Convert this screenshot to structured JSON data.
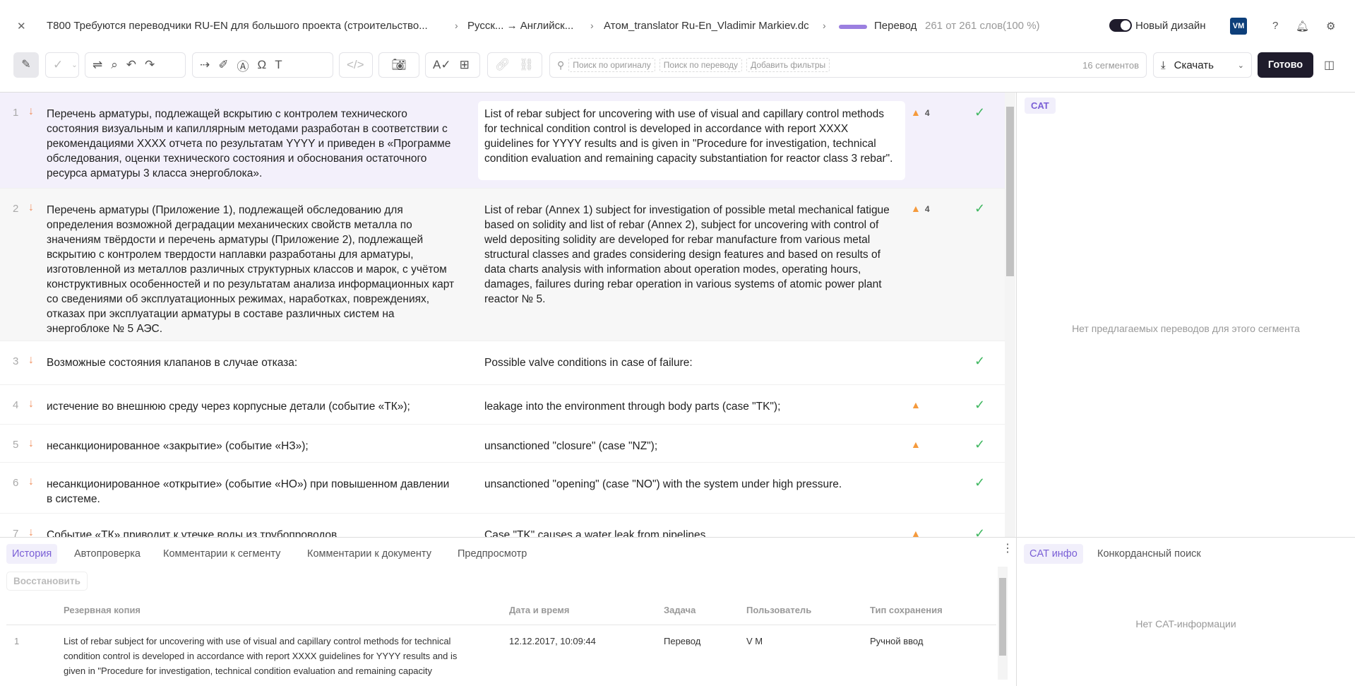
{
  "header": {
    "close_icon": "close-icon",
    "project": "T800 Требуются переводчики RU-EN для большого проекта (строительство...",
    "languages": "Русск... → Английск...",
    "document": "Атом_translator Ru-En_Vladimir Markiev.dc",
    "stage": "Перевод",
    "progress_text": "261 от 261 слов",
    "progress_percent": "(100 %)",
    "progress_value": 100,
    "stage_color": "#9b7fe0",
    "new_design_label": "Новый дизайн",
    "new_design_on": true,
    "avatar": "VM",
    "avatar_color": "#0d3f7a"
  },
  "toolbar": {
    "search_original": "Поиск по оригиналу",
    "search_translation": "Поиск по переводу",
    "add_filters": "Добавить фильтры",
    "segments_count": "16 сегментов",
    "download": "Скачать",
    "done": "Готово"
  },
  "segments": [
    {
      "num": "1",
      "source": "Перечень арматуры, подлежащей вскрытию с контролем технического состояния визуальным и капиллярным методами разработан в соответствии с рекомендациями XXXX отчета по результатам YYYY и приведен в «Программе обследования, оценки технического состояния и обоснования остаточного ресурса арматуры 3 класса энергоблока».",
      "target": "List of rebar subject for uncovering with use of visual and capillary control methods for technical condition control is developed in accordance with report XXXX guidelines for YYYY results and is given in \"Procedure for investigation, technical condition evaluation and remaining capacity substantiation for reactor class 3 rebar\".",
      "warnings": "4",
      "confirmed": true
    },
    {
      "num": "2",
      "source": "Перечень арматуры (Приложение 1), подлежащей обследованию для определения возможной деградации механических свойств металла по значениям твёрдости и перечень арматуры (Приложение 2), подлежащей вскрытию с контролем твердости наплавки разработаны для арматуры, изготовленной из металлов различных структурных классов и марок, с учётом конструктивных особенностей и по результатам анализа информационных карт со сведениями об эксплуатационных режимах, наработках, повреждениях, отказах при эксплуатации арматуры в составе различных систем на энергоблоке № 5 АЭС.",
      "target": "List of rebar (Annex 1) subject for investigation of possible metal mechanical fatigue based on solidity and list of rebar (Annex 2), subject for uncovering with control of weld depositing solidity are developed for rebar manufacture from various metal structural classes and grades considering design features and based on results of data charts analysis with information about operation modes, operating hours, damages, failures during rebar operation in various systems of atomic power plant reactor № 5.",
      "warnings": "4",
      "confirmed": true
    },
    {
      "num": "3",
      "source": "Возможные состояния клапанов в случае отказа:",
      "target": "Possible valve conditions in case of failure:",
      "warnings": "",
      "confirmed": true
    },
    {
      "num": "4",
      "source": "истечение во внешнюю среду через корпусные детали (событие «ТК»);",
      "target": "leakage into the environment through body parts (case \"TK\");",
      "warnings": "",
      "confirmed": true
    },
    {
      "num": "5",
      "source": "несанкционированное «закрытие» (событие «НЗ»);",
      "target": "unsanctioned  \"closure\" (case \"NZ\");",
      "warnings": "",
      "confirmed": true
    },
    {
      "num": "6",
      "source": "несанкционированное «открытие» (событие «НО») при повышенном давлении в системе.",
      "target": "unsanctioned \"opening\" (case \"NO\") with the system under high pressure.",
      "warnings": "",
      "confirmed": true
    },
    {
      "num": "7",
      "source": "Событие «ТК» приводит к утечке воды из трубопроводов.",
      "target": "Case \"TK\" causes a water leak from pipelines.",
      "warnings": "",
      "confirmed": true
    }
  ],
  "cat_panel": {
    "tab": "CAT",
    "empty": "Нет предлагаемых переводов для этого сегмента"
  },
  "bottom": {
    "tabs": [
      "История",
      "Автопроверка",
      "Комментарии к сегменту",
      "Комментарии к документу",
      "Предпросмотр"
    ],
    "restore": "Восстановить",
    "columns": [
      "Резервная копия",
      "Дата и время",
      "Задача",
      "Пользователь",
      "Тип сохранения"
    ],
    "rows": [
      {
        "num": "1",
        "text": "List of rebar subject for uncovering with use of visual and capillary control methods for technical condition control is developed in accordance with report XXXX guidelines for YYYY results and is given in \"Procedure for investigation, technical condition evaluation and remaining capacity",
        "date": "12.12.2017, 10:09:44",
        "task": "Перевод",
        "user": "V M",
        "type": "Ручной ввод"
      }
    ]
  },
  "cat_info": {
    "tabs": [
      "CAT инфо",
      "Конкордансный поиск"
    ],
    "empty": "Нет CAT-информации"
  }
}
